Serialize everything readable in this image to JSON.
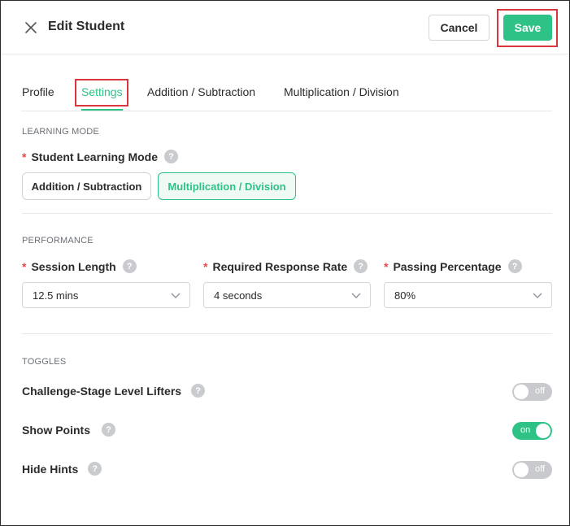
{
  "header": {
    "title": "Edit Student",
    "cancel_label": "Cancel",
    "save_label": "Save"
  },
  "tabs": [
    {
      "label": "Profile",
      "active": false
    },
    {
      "label": "Settings",
      "active": true
    },
    {
      "label": "Addition / Subtraction",
      "active": false
    },
    {
      "label": "Multiplication / Division",
      "active": false
    }
  ],
  "learning_mode": {
    "section_label": "LEARNING MODE",
    "field_label": "Student Learning Mode",
    "required_mark": "*",
    "help_mark": "?",
    "options": [
      {
        "label": "Addition / Subtraction",
        "selected": false
      },
      {
        "label": "Multiplication / Division",
        "selected": true
      }
    ]
  },
  "performance": {
    "section_label": "PERFORMANCE",
    "fields": [
      {
        "label": "Session Length",
        "value": "12.5 mins"
      },
      {
        "label": "Required Response Rate",
        "value": "4 seconds"
      },
      {
        "label": "Passing Percentage",
        "value": "80%"
      }
    ]
  },
  "toggles": {
    "section_label": "TOGGLES",
    "items": [
      {
        "label": "Challenge-Stage Level Lifters",
        "state": "off"
      },
      {
        "label": "Show Points",
        "state": "on"
      },
      {
        "label": "Hide Hints",
        "state": "off"
      }
    ]
  },
  "colors": {
    "accent": "#2fc286",
    "highlight": "#d9363e",
    "required": "#e5484d"
  },
  "icons": {
    "close": "close-icon",
    "chevron": "chevron-down-icon",
    "help": "help-icon"
  }
}
